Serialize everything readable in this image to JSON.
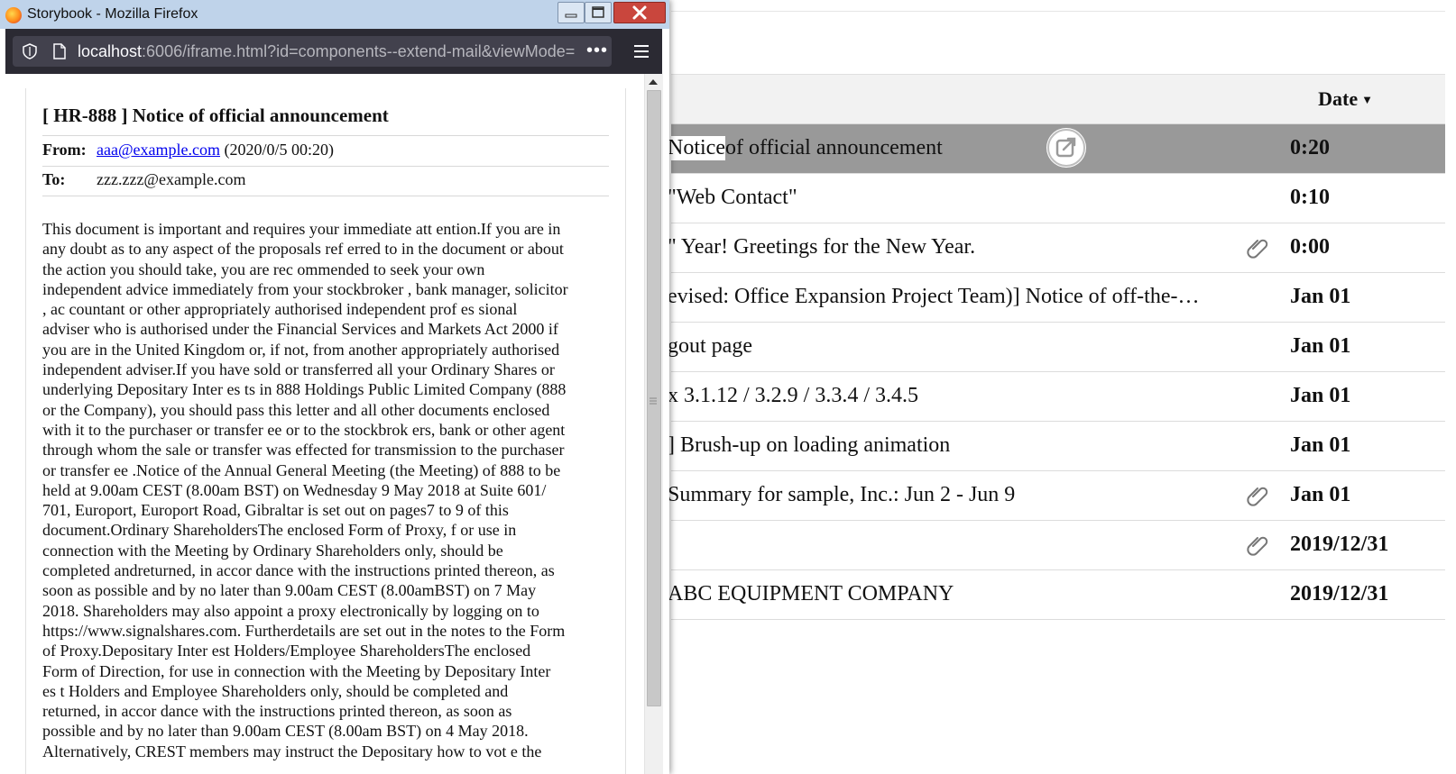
{
  "window": {
    "title": "Storybook - Mozilla Firefox",
    "url_host": "localhost",
    "url_rest": ":6006/iframe.html?id=components--extend-mail&viewMode=",
    "more_label": "•••"
  },
  "mail": {
    "subject": "[ HR-888 ] Notice of official announcement",
    "from_label": "From:",
    "from_email": "aaa@example.com",
    "from_date": "(2020/0/5 00:20)",
    "to_label": "To:",
    "to_value": "zzz.zzz@example.com",
    "body_lines": [
      "This document is important and requires your immediate att ention.If you are in",
      "any doubt as to any aspect of the proposals ref erred to in the document or about",
      "the action you should take, you are rec ommended to seek your own",
      "independent advice immediately from your stockbroker , bank manager, solicitor",
      ", ac countant or other appropriately authorised independent prof es sional",
      "adviser who is authorised under the Financial Services and Markets Act 2000 if",
      "you are in the United Kingdom or, if not, from another appropriately authorised",
      "independent adviser.If you have sold or transferred all your Ordinary Shares or",
      "underlying Depositary Inter es ts in 888 Holdings Public Limited Company (888",
      "or the Company), you should pass this letter and all other documents enclosed",
      "with it to the purchaser or transfer ee or to the stockbrok ers, bank or other agent",
      "through whom the sale or transfer was effected for transmission to the purchaser",
      "or transfer ee .Notice of the Annual General Meeting (the Meeting) of 888 to be",
      "held at 9.00am CEST (8.00am BST) on Wednesday 9 May 2018 at Suite 601/",
      "701, Europort, Europort Road, Gibraltar is set out on pages7 to 9 of this",
      "document.Ordinary ShareholdersThe enclosed Form of Proxy, f or use in",
      "connection with the Meeting by Ordinary Shareholders only, should be",
      "completed andreturned, in accor dance with the instructions printed thereon, as",
      "soon as possible and by no later than 9.00am CEST (8.00amBST) on 7 May",
      "2018. Shareholders may also appoint a proxy electronically by logging on to",
      "https://www.signalshares.com. Furtherdetails are set out in the notes to the Form",
      "of Proxy.Depositary Inter est Holders/Employee ShareholdersThe enclosed",
      "Form of Direction, for use in connection with the Meeting by Depositary Inter",
      "es t Holders and Employee Shareholders only, should be completed and",
      "returned, in accor dance with the instructions printed thereon, as soon as",
      "possible and by no later than 9.00am CEST (8.00am BST) on 4 May 2018.",
      "Alternatively, CREST members may instruct the Depositary how to vot e the"
    ]
  },
  "list": {
    "date_header": "Date",
    "rows": [
      {
        "subject_a": "Notice ",
        "subject_b": "of official announcement",
        "date": "0:20",
        "attachment": false,
        "selected": true
      },
      {
        "subject": "\"Web Contact\"",
        "date": "0:10",
        "attachment": false
      },
      {
        "subject": "\" Year! Greetings for the New Year.",
        "date": "0:00",
        "attachment": true
      },
      {
        "subject": "evised: Office Expansion Project Team)] Notice of off-the-…",
        "date": "Jan 01",
        "attachment": false
      },
      {
        "subject": "gout page",
        "date": "Jan 01",
        "attachment": false
      },
      {
        "subject": "x 3.1.12 / 3.2.9 / 3.3.4 / 3.4.5",
        "date": "Jan 01",
        "attachment": false
      },
      {
        "subject": "] Brush-up on loading animation",
        "date": "Jan 01",
        "attachment": false
      },
      {
        "subject": "Summary for sample, Inc.: Jun 2 - Jun 9",
        "date": "Jan 01",
        "attachment": true
      },
      {
        "subject": "",
        "date": "2019/12/31",
        "attachment": true
      },
      {
        "subject": "ABC EQUIPMENT COMPANY",
        "date": "2019/12/31",
        "attachment": false
      }
    ]
  }
}
